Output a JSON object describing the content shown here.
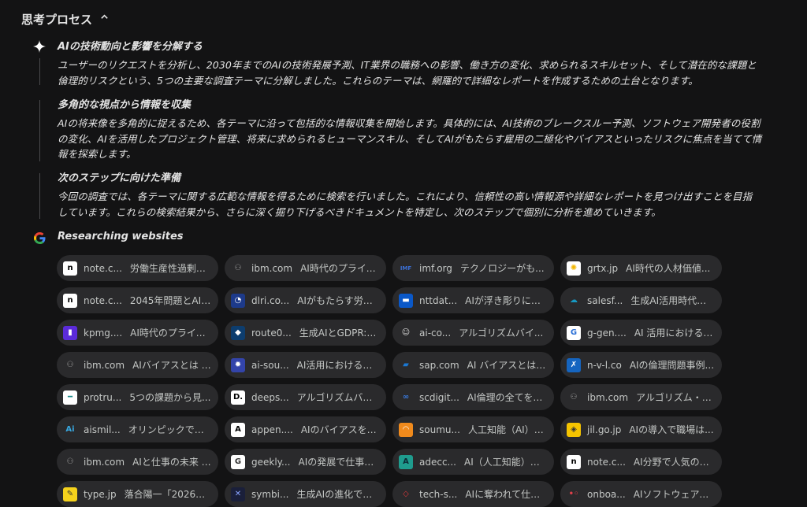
{
  "header": {
    "title": "思考プロセス",
    "chevron": "chevron-up-icon"
  },
  "steps": [
    {
      "title": "AIの技術動向と影響を分解する",
      "line1": "ユーザーのリクエストを分析し、2030年までのAIの技術発展予測、IT業界の職務への影響、働き方の変化、求められるスキルセット、そして潜在的な課題と",
      "line2": "倫理的リスクという、5つの主要な調査テーマに分解しました。これらのテーマは、網羅的で詳細なレポートを作成するための土台となります。"
    },
    {
      "title": "多角的な視点から情報を収集",
      "line1": "AIの将来像を多角的に捉えるため、各テーマに沿って包括的な情報収集を開始します。具体的には、AI技術のブレークスルー予測、ソフトウェア開発者の役割",
      "line2": "の変化、AIを活用したプロジェクト管理、将来に求められるヒューマンスキル、そしてAIがもたらす雇用の二極化やバイアスといったリスクに焦点を当てて情",
      "line3": "報を探索します。"
    },
    {
      "title": "次のステップに向けた準備",
      "line1": "今回の調査では、各テーマに関する広範な情報を得るために検索を行いました。これにより、信頼性の高い情報源や詳細なレポートを見つけ出すことを目指",
      "line2": "しています。これらの検索結果から、さらに深く掘り下げるべきドキュメントを特定し、次のステップで個別に分析を進めていきます。"
    }
  ],
  "research": {
    "title": "Researching websites",
    "icon": "google-icon"
  },
  "sources": [
    {
      "domain": "note.c...",
      "title": "労働生産性過剰重...",
      "icon": "note",
      "bg": "#ffffff",
      "fg": "#000000",
      "glyph": "n"
    },
    {
      "domain": "ibm.com",
      "title": "AI時代のプライバ...",
      "icon": "ibm",
      "bg": "#2a2a2c",
      "fg": "#9a9a9a",
      "glyph": "⚇"
    },
    {
      "domain": "imf.org",
      "title": "テクノロジーがも...",
      "icon": "imf",
      "bg": "#2a2a2c",
      "fg": "#3b6fd4",
      "glyph": "IMF"
    },
    {
      "domain": "grtx.jp",
      "title": "AI時代の人材価値...",
      "icon": "grtx",
      "bg": "#ffffff",
      "fg": "#f2b600",
      "glyph": "✺"
    },
    {
      "domain": "note.c...",
      "title": "2045年問題とAIの...",
      "icon": "note",
      "bg": "#ffffff",
      "fg": "#000000",
      "glyph": "n"
    },
    {
      "domain": "dlri.co...",
      "title": "AIがもたらす労働...",
      "icon": "dlri",
      "bg": "#1d3a8a",
      "fg": "#ffffff",
      "glyph": "◔"
    },
    {
      "domain": "nttdat...",
      "title": "AIが浮き彫りにし...",
      "icon": "nttdata",
      "bg": "#0a58c8",
      "fg": "#ffffff",
      "glyph": "▬"
    },
    {
      "domain": "salesf...",
      "title": "生成AI活用時代の...",
      "icon": "salesforce",
      "bg": "#2a2a2c",
      "fg": "#1798c1",
      "glyph": "☁"
    },
    {
      "domain": "kpmg....",
      "title": "AI時代のプライバ...",
      "icon": "kpmg",
      "bg": "#5b2bd9",
      "fg": "#ffffff",
      "glyph": "▮"
    },
    {
      "domain": "route0...",
      "title": "生成AIとGDPR: デ...",
      "icon": "route",
      "bg": "#0d3d6e",
      "fg": "#ffffff",
      "glyph": "◆"
    },
    {
      "domain": "ai-co...",
      "title": "アルゴリズムバイ...",
      "icon": "aico",
      "bg": "#2a2a2c",
      "fg": "#dddddd",
      "glyph": "☺"
    },
    {
      "domain": "g-gen....",
      "title": "AI 活用における倫...",
      "icon": "ggen",
      "bg": "#ffffff",
      "fg": "#2a6fd6",
      "glyph": "G"
    },
    {
      "domain": "ibm.com",
      "title": "AIバイアスとは - I...",
      "icon": "ibm",
      "bg": "#2a2a2c",
      "fg": "#9a9a9a",
      "glyph": "⚇"
    },
    {
      "domain": "ai-sou...",
      "title": "AI活用における倫...",
      "icon": "aisou",
      "bg": "#3344aa",
      "fg": "#ffffff",
      "glyph": "✹"
    },
    {
      "domain": "sap.com",
      "title": "AI バイアスとは？...",
      "icon": "sap",
      "bg": "#2a2a2c",
      "fg": "#1b78d3",
      "glyph": "▰"
    },
    {
      "domain": "n-v-l.co",
      "title": "AIの倫理問題事例...",
      "icon": "nvl",
      "bg": "#1565c0",
      "fg": "#ffffff",
      "glyph": "✗"
    },
    {
      "domain": "protru...",
      "title": "5つの課題から見...",
      "icon": "protrude",
      "bg": "#ffffff",
      "fg": "#1a8a8a",
      "glyph": "━"
    },
    {
      "domain": "deeps...",
      "title": "アルゴリズムバイ...",
      "icon": "deepsquare",
      "bg": "#ffffff",
      "fg": "#000000",
      "glyph": "D."
    },
    {
      "domain": "scdigit...",
      "title": "AI倫理の全てを学...",
      "icon": "scdigital",
      "bg": "#2a2a2c",
      "fg": "#3a7be0",
      "glyph": "∞"
    },
    {
      "domain": "ibm.com",
      "title": "アルゴリズム・バ...",
      "icon": "ibm",
      "bg": "#2a2a2c",
      "fg": "#9a9a9a",
      "glyph": "⚇"
    },
    {
      "domain": "aismil...",
      "title": "オリンピックで再...",
      "icon": "aismiley",
      "bg": "#2a2a2c",
      "fg": "#38a8e0",
      "glyph": "Ai"
    },
    {
      "domain": "appen....",
      "title": "AIのバイアスを防...",
      "icon": "appen",
      "bg": "#ffffff",
      "fg": "#000000",
      "glyph": "A"
    },
    {
      "domain": "soumu...",
      "title": "人工知能（AI）の...",
      "icon": "soumu",
      "bg": "#f08a1c",
      "fg": "#ffffff",
      "glyph": "◠"
    },
    {
      "domain": "jil.go.jp",
      "title": "AIの導入で職場は...",
      "icon": "jil",
      "bg": "#f5c400",
      "fg": "#333333",
      "glyph": "◈"
    },
    {
      "domain": "ibm.com",
      "title": "AIと仕事の未来 | I...",
      "icon": "ibm",
      "bg": "#2a2a2c",
      "fg": "#9a9a9a",
      "glyph": "⚇"
    },
    {
      "domain": "geekly...",
      "title": "AIの発展で仕事が...",
      "icon": "geekly",
      "bg": "#ffffff",
      "fg": "#333333",
      "glyph": "G"
    },
    {
      "domain": "adecc...",
      "title": "AI（人工知能）は...",
      "icon": "adecco",
      "bg": "#1f9c8e",
      "fg": "#0d2a36",
      "glyph": "A"
    },
    {
      "domain": "note.c...",
      "title": "AI分野で人気の新...",
      "icon": "note",
      "bg": "#ffffff",
      "fg": "#000000",
      "glyph": "n"
    },
    {
      "domain": "type.jp",
      "title": "落合陽一「2026年...",
      "icon": "type",
      "bg": "#f5d21c",
      "fg": "#333333",
      "glyph": "✎"
    },
    {
      "domain": "symbi...",
      "title": "生成AIの進化でデ...",
      "icon": "symbi",
      "bg": "#1a1f3a",
      "fg": "#8aa4ff",
      "glyph": "✕"
    },
    {
      "domain": "tech-s...",
      "title": "AIに奪われて仕事...",
      "icon": "techs",
      "bg": "#2a2a2c",
      "fg": "#d6383a",
      "glyph": "◇"
    },
    {
      "domain": "onboa...",
      "title": "AIソフトウェアと...",
      "icon": "onboard",
      "bg": "#2a2a2c",
      "fg": "#e0404a",
      "glyph": "•◦"
    }
  ]
}
